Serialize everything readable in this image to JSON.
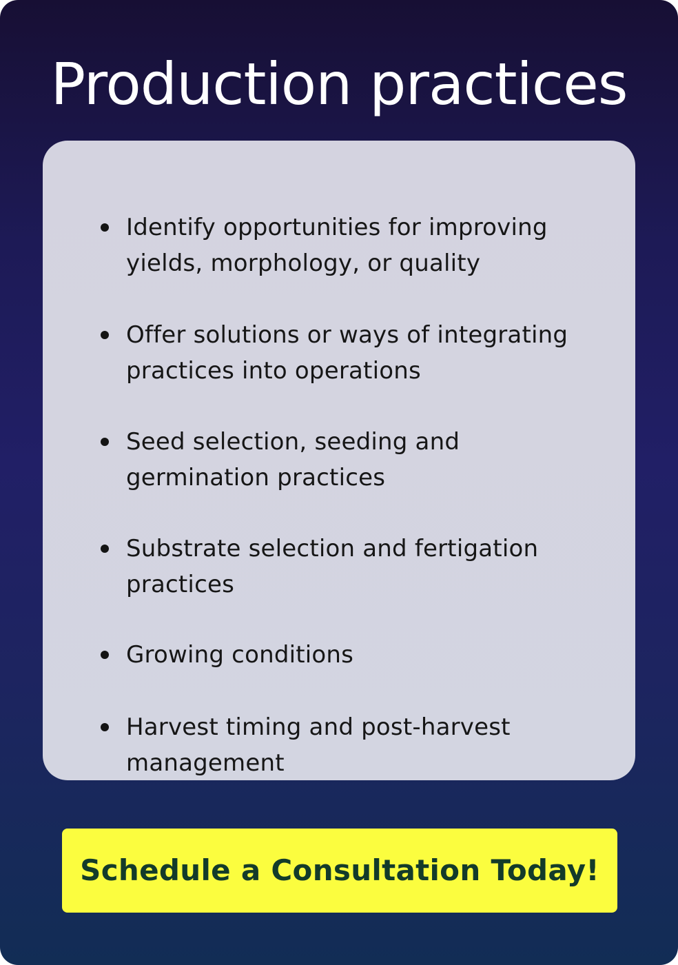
{
  "header": {
    "title": "Production practices"
  },
  "panel": {
    "items": [
      {
        "text": "Identify opportunities for improving yields, morphology, or quality"
      },
      {
        "text": "Offer solutions or ways of integrating practices into operations"
      },
      {
        "text": "Seed selection, seeding and germination practices"
      },
      {
        "text": "Substrate selection and fertigation practices"
      },
      {
        "text": "Growing conditions"
      },
      {
        "text": "Harvest timing and post-harvest management"
      }
    ]
  },
  "cta": {
    "label": "Schedule a Consultation Today!"
  },
  "colors": {
    "background_top": "#170f34",
    "background_mid": "#211f66",
    "background_bottom": "#122d55",
    "panel": "#d4d4e0",
    "cta_background": "#fbfd3f",
    "cta_text": "#133b2a"
  }
}
